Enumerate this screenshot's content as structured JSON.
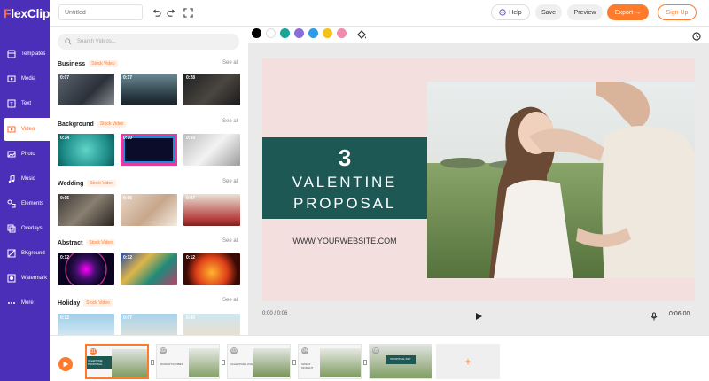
{
  "app": {
    "logo_first": "F",
    "logo_rest": "lexClip"
  },
  "topbar": {
    "title_value": "",
    "title_placeholder": "Untitled",
    "help": "Help",
    "save": "Save",
    "preview": "Preview",
    "export": "Export",
    "export_arrow": "→",
    "signup": "Sign Up"
  },
  "sidebar": {
    "items": [
      {
        "label": "Templates",
        "icon": "templates-icon"
      },
      {
        "label": "Media",
        "icon": "media-icon"
      },
      {
        "label": "Text",
        "icon": "text-icon"
      },
      {
        "label": "Video",
        "icon": "video-icon"
      },
      {
        "label": "Photo",
        "icon": "photo-icon"
      },
      {
        "label": "Music",
        "icon": "music-icon"
      },
      {
        "label": "Elements",
        "icon": "elements-icon"
      },
      {
        "label": "Overlays",
        "icon": "overlays-icon"
      },
      {
        "label": "BKground",
        "icon": "background-icon"
      },
      {
        "label": "Watermark",
        "icon": "watermark-icon"
      },
      {
        "label": "More",
        "icon": "more-icon"
      }
    ],
    "active_index": 3
  },
  "panel": {
    "search_placeholder": "Search Videos...",
    "see_all": "See all",
    "sections": [
      {
        "title": "Business",
        "badge": "Stock Video",
        "durations": [
          "0:07",
          "0:17",
          "0:28"
        ]
      },
      {
        "title": "Background",
        "badge": "Stock Video",
        "durations": [
          "0:14",
          "0:10",
          "0:39"
        ]
      },
      {
        "title": "Wedding",
        "badge": "Stock Video",
        "durations": [
          "0:05",
          "0:06",
          "0:07"
        ]
      },
      {
        "title": "Abstract",
        "badge": "Stock Video",
        "durations": [
          "0:12",
          "0:12",
          "0:12"
        ]
      },
      {
        "title": "Holiday",
        "badge": "Stock Video",
        "durations": [
          "0:12",
          "0:07",
          "0:40"
        ]
      }
    ]
  },
  "colors": [
    "#000000",
    "#ffffff",
    "#1aa597",
    "#8c6cd9",
    "#2e9be8",
    "#f5c018",
    "#f08bab"
  ],
  "canvas": {
    "number": "3",
    "line1": "VALENTINE",
    "line2": "PROPOSAL",
    "website": "WWW.YOURWEBSITE.COM"
  },
  "playback": {
    "current": "0:00 / 0:06",
    "total": "0:06.00"
  },
  "clips": [
    {
      "num": "01",
      "caption": "VALENTINE PROPOSAL"
    },
    {
      "num": "02",
      "caption": "ROMANTIC VIBES"
    },
    {
      "num": "03",
      "caption": "VALENTINE LOVE"
    },
    {
      "num": "04",
      "caption": "SWEET MOMENT"
    },
    {
      "num": "05",
      "caption": "PROPOSAL DAY"
    }
  ],
  "add_clip": "+"
}
